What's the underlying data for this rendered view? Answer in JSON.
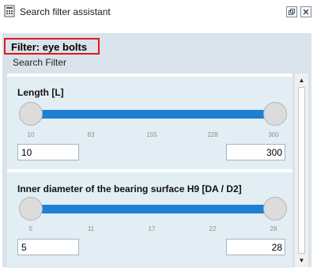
{
  "window": {
    "title": "Search filter assistant",
    "icon": "calculator-grid-icon"
  },
  "panel": {
    "filter_title": "Filter: eye bolts",
    "subtitle": "Search Filter"
  },
  "filters": [
    {
      "label": "Length [L]",
      "ticks": [
        "10",
        "83",
        "155",
        "228",
        "300"
      ],
      "min_value": "10",
      "max_value": "300",
      "range_selected": [
        10,
        300
      ]
    },
    {
      "label": "Inner diameter of the bearing surface H9 [DA / D2]",
      "ticks": [
        "5",
        "11",
        "17",
        "22",
        "28"
      ],
      "min_value": "5",
      "max_value": "28",
      "range_selected": [
        5,
        28
      ]
    }
  ],
  "colors": {
    "accent": "#1d80d2",
    "highlight_border": "#e01818",
    "panel_bg": "#d9e3eb",
    "section_bg": "#e2eef4"
  }
}
